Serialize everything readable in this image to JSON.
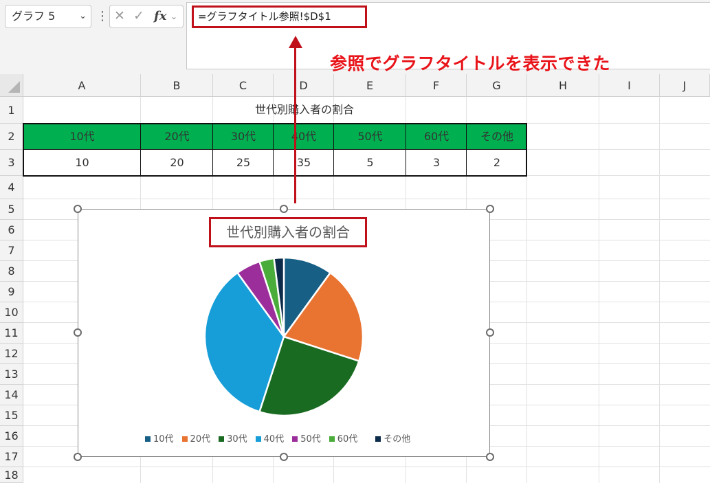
{
  "formula_bar": {
    "name_box": "グラフ 5",
    "formula": "=グラフタイトル参照!$D$1"
  },
  "annotation": "参照でグラフタイトルを表示できた",
  "columns": [
    "A",
    "B",
    "C",
    "D",
    "E",
    "F",
    "G",
    "H",
    "I",
    "J"
  ],
  "rows": [
    "1",
    "2",
    "3",
    "4",
    "5",
    "6",
    "7",
    "8",
    "9",
    "10",
    "11",
    "12",
    "13",
    "14",
    "15",
    "16",
    "17",
    "18"
  ],
  "sheet": {
    "title": "世代別購入者の割合",
    "headers": [
      "10代",
      "20代",
      "30代",
      "40代",
      "50代",
      "60代",
      "その他"
    ],
    "values": [
      "10",
      "20",
      "25",
      "35",
      "5",
      "3",
      "2"
    ]
  },
  "colors": {
    "header_fill": "#00b050",
    "highlight_border": "#c0101a",
    "annotation_text": "#e8141a"
  },
  "chart_data": {
    "type": "pie",
    "title": "世代別購入者の割合",
    "categories": [
      "10代",
      "20代",
      "30代",
      "40代",
      "50代",
      "60代",
      "その他"
    ],
    "values": [
      10,
      20,
      25,
      35,
      5,
      3,
      2
    ],
    "colors": [
      "#175f85",
      "#e97331",
      "#1a6b22",
      "#179dd7",
      "#9b2e9b",
      "#4aac3b",
      "#0c2b4a"
    ],
    "legend_position": "bottom"
  }
}
